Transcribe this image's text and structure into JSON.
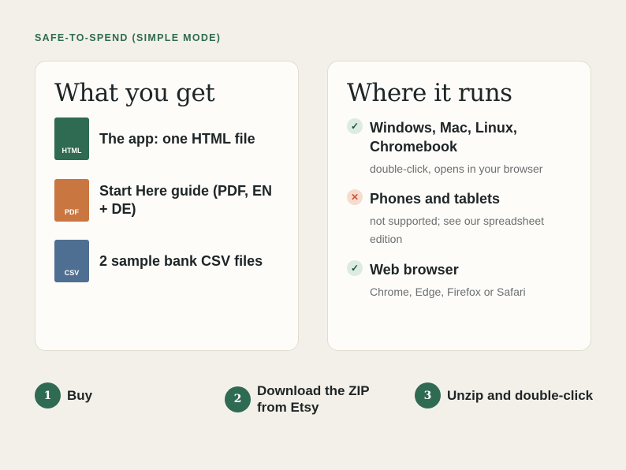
{
  "eyebrow": "SAFE-TO-SPEND (SIMPLE MODE)",
  "colors": {
    "background": "#f3f0e9",
    "accent": "#2e6b52",
    "html_file": "#2e6b52",
    "pdf_file": "#c97640",
    "csv_file": "#4f6f92",
    "not_supported": "#c85a3a"
  },
  "what_you_get": {
    "title": "What you get",
    "items": [
      {
        "type": "HTML",
        "label": "The app: one HTML file"
      },
      {
        "type": "PDF",
        "label": "Start Here guide (PDF, EN + DE)"
      },
      {
        "type": "CSV",
        "label": "2 sample bank CSV files"
      }
    ]
  },
  "where_it_runs": {
    "title": "Where it runs",
    "items": [
      {
        "status": "check-icon",
        "mark": "✓",
        "title": "Windows, Mac, Linux, Chromebook",
        "subtitle": "double-click, opens in your browser"
      },
      {
        "status": "cross-icon",
        "mark": "✕",
        "title": "Phones and tablets",
        "subtitle": "not supported; see our spreadsheet edition"
      },
      {
        "status": "check-icon",
        "mark": "✓",
        "title": "Web browser",
        "subtitle": "Chrome, Edge, Firefox or Safari"
      }
    ]
  },
  "steps": [
    {
      "number": "1",
      "label": "Buy"
    },
    {
      "number": "2",
      "label": "Download the ZIP from Etsy"
    },
    {
      "number": "3",
      "label": "Unzip and double-click"
    }
  ]
}
